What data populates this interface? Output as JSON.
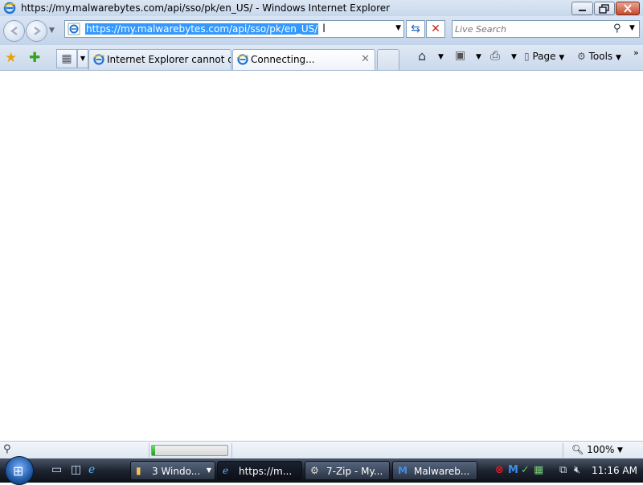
{
  "window": {
    "title": "https://my.malwarebytes.com/api/sso/pk/en_US/ - Windows Internet Explorer"
  },
  "navbar": {
    "url": "https://my.malwarebytes.com/api/sso/pk/en_US/",
    "search_placeholder": "Live Search"
  },
  "tabs": [
    {
      "label": "Internet Explorer cannot di...",
      "active": false
    },
    {
      "label": "Connecting...",
      "active": true
    }
  ],
  "commandbar": {
    "page_label": "Page",
    "tools_label": "Tools"
  },
  "statusbar": {
    "zoom": "100%",
    "progress": 0.04
  },
  "taskbar": {
    "tasks": [
      {
        "label": "3 Windo...",
        "icon": "folder-icon"
      },
      {
        "label": "https://m...",
        "icon": "ie-icon"
      },
      {
        "label": "7-Zip - My...",
        "icon": "7zip-icon"
      },
      {
        "label": "Malwareb...",
        "icon": "malwarebytes-icon"
      }
    ],
    "clock": "11:16 AM"
  }
}
